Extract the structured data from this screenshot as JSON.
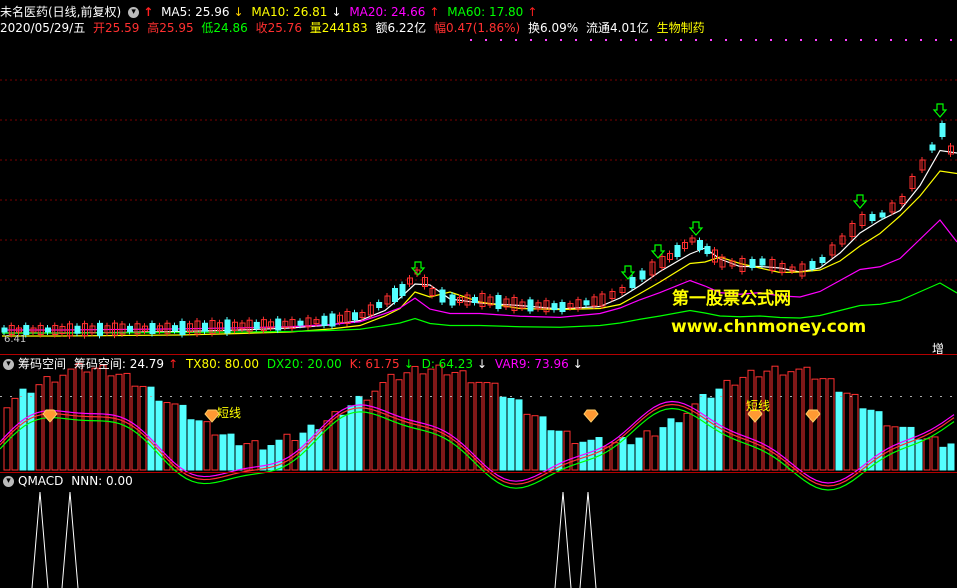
{
  "header": {
    "title": "未名医药(日线,前复权)",
    "ma5": "MA5: 25.96",
    "ma10": "MA10: 26.81",
    "ma20": "MA20: 24.66",
    "ma60": "MA60: 17.80",
    "date": "2020/05/29/五",
    "open": "开25.59",
    "high": "高25.95",
    "low": "低24.86",
    "close": "收25.76",
    "volume": "量244183",
    "amount": "额6.22亿",
    "change": "幅0.47(1.86%)",
    "turnover": "换6.09%",
    "float": "流通4.01亿",
    "sector": "生物制药"
  },
  "main_chart": {
    "low_label": "6.41",
    "corner_label": "增",
    "watermark_cn": "第一股票公式网",
    "watermark_url": "www.chnmoney.com"
  },
  "indicator": {
    "name": "筹码空间",
    "value": "筹码空间: 24.79",
    "tx80": "TX80: 80.00",
    "dx20": "DX20: 20.00",
    "k": "K: 61.75",
    "d": "D: 64.23",
    "var9": "VAR9: 73.96",
    "tag_left": "短线",
    "tag_right": "短线"
  },
  "qmacd": {
    "label": "QMACD",
    "nnn": "NNN: 0.00"
  },
  "colors": {
    "up": "#ff3030",
    "down": "#54ffff",
    "ma5": "#ffffff",
    "ma10": "#ffff00",
    "ma20": "#ff00ff",
    "ma60": "#00ff00",
    "grid": "#7a0000"
  }
}
